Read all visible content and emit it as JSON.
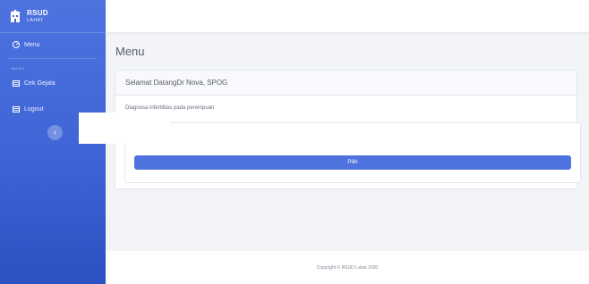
{
  "brand": {
    "title": "RSUD",
    "subtitle": "LAHAT"
  },
  "sidebar": {
    "menu_label": "Menu",
    "section_heading": "MENU",
    "items": [
      {
        "label": "Cek Gejala",
        "icon": "table-icon"
      },
      {
        "label": "Logout",
        "icon": "table-icon"
      }
    ],
    "toggle_symbol": "‹"
  },
  "main": {
    "page_title": "Menu",
    "card_header": "Selamat DatangDr Nova, SPOG",
    "diagnosis_text": "Diagnosa infertilitas pada perempuan",
    "pilih_label": "Pilih"
  },
  "footer": {
    "copyright": "Copyright © RSUD Lahat 2020"
  },
  "colors": {
    "primary": "#4e73df",
    "sidebar_dark": "#2b50c0",
    "background": "#f3f4f8"
  }
}
